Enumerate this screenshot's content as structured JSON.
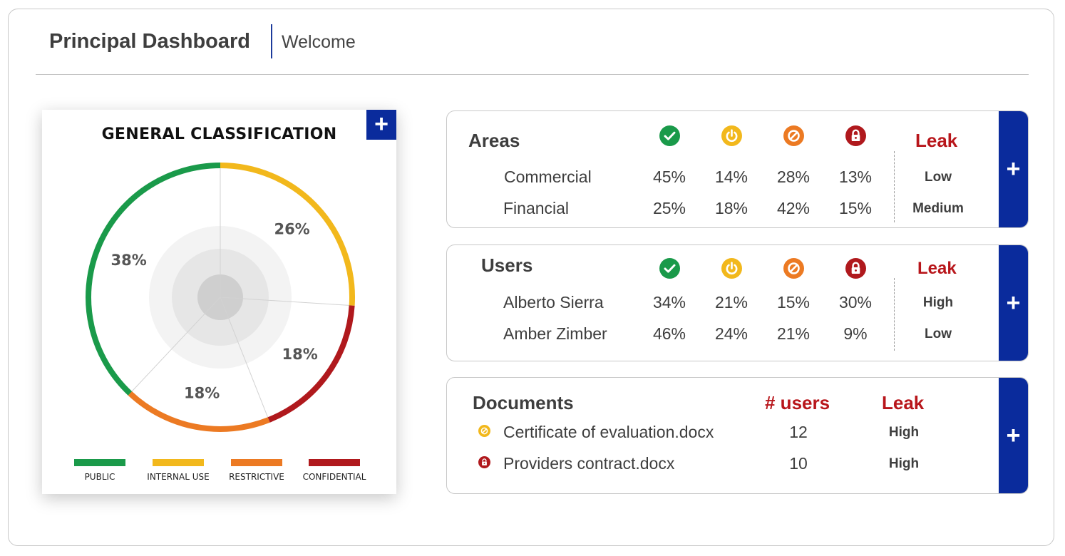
{
  "header": {
    "title": "Principal Dashboard",
    "subtitle": "Welcome"
  },
  "chart_data": {
    "type": "pie",
    "title": "GENERAL CLASSIFICATION",
    "categories": [
      "PUBLIC",
      "INTERNAL USE",
      "RESTRICTIVE",
      "CONFIDENTIAL"
    ],
    "values": [
      38,
      26,
      18,
      18
    ],
    "data_labels": [
      "38%",
      "26%",
      "18%",
      "18%"
    ],
    "colors": [
      "#1a9a4a",
      "#f2b81c",
      "#ec7a23",
      "#b0191d"
    ],
    "legend_position": "bottom",
    "add_label": "+"
  },
  "status_icons": [
    {
      "name": "public-check-icon",
      "color": "#1a9a4a"
    },
    {
      "name": "internal-power-icon",
      "color": "#f2b81c"
    },
    {
      "name": "restrictive-block-icon",
      "color": "#ec7a23"
    },
    {
      "name": "confidential-lock-icon",
      "color": "#b0191d"
    }
  ],
  "areas": {
    "title": "Areas",
    "leak_header": "Leak",
    "add_label": "+",
    "rows": [
      {
        "name": "Commercial",
        "values": [
          "45%",
          "14%",
          "28%",
          "13%"
        ],
        "leak": "Low"
      },
      {
        "name": "Financial",
        "values": [
          "25%",
          "18%",
          "42%",
          "15%"
        ],
        "leak": "Medium"
      }
    ]
  },
  "users": {
    "title": "Users",
    "leak_header": "Leak",
    "add_label": "+",
    "rows": [
      {
        "name": "Alberto Sierra",
        "values": [
          "34%",
          "21%",
          "15%",
          "30%"
        ],
        "leak": "High"
      },
      {
        "name": "Amber Zimber",
        "values": [
          "46%",
          "24%",
          "21%",
          "9%"
        ],
        "leak": "Low"
      }
    ]
  },
  "documents": {
    "title": "Documents",
    "users_header": "# users",
    "leak_header": "Leak",
    "add_label": "+",
    "rows": [
      {
        "icon": "restrictive-block-icon",
        "icon_color": "#f2b81c",
        "name": "Certificate of evaluation.docx",
        "users": "12",
        "leak": "High"
      },
      {
        "icon": "confidential-lock-icon",
        "icon_color": "#b0191d",
        "name": "Providers contract.docx",
        "users": "10",
        "leak": "High"
      }
    ]
  }
}
